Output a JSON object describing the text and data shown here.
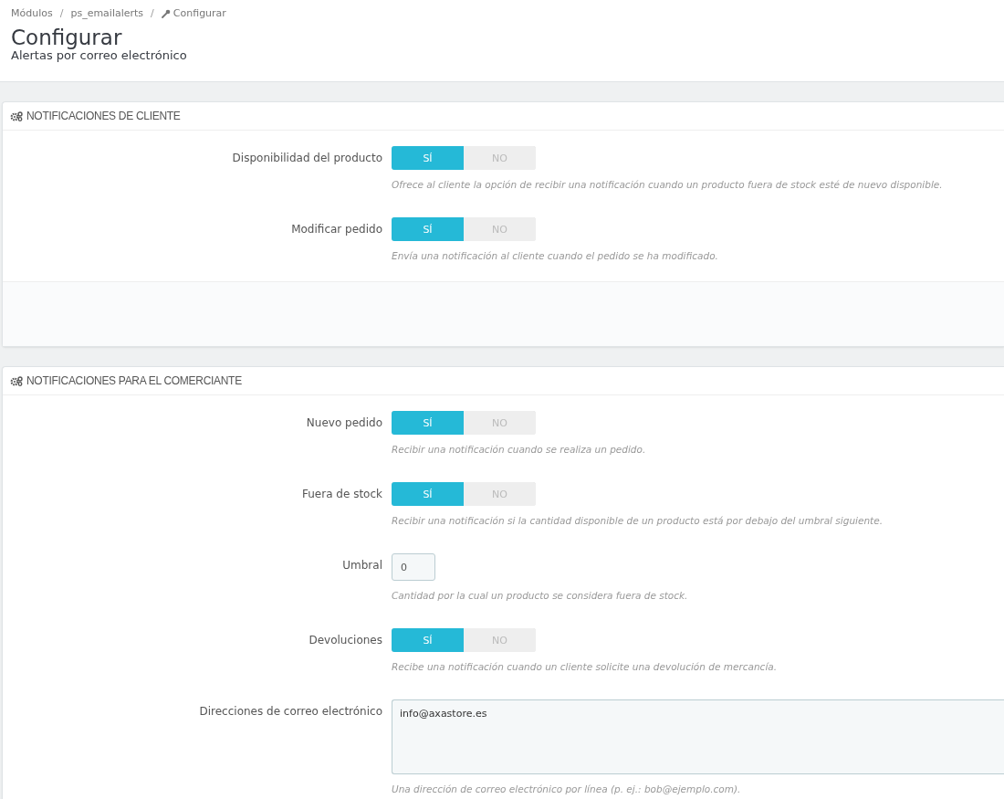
{
  "breadcrumb": [
    {
      "label": "Módulos",
      "icon": false
    },
    {
      "label": "ps_emailalerts",
      "icon": false
    },
    {
      "label": "Configurar",
      "icon": true
    }
  ],
  "breadcrumb_separators": [
    "/",
    "/"
  ],
  "page_title": "Configurar",
  "page_subtitle": "Alertas por correo electrónico",
  "panels": [
    {
      "title": "NOTIFICACIONES DE CLIENTE",
      "fields": [
        {
          "kind": "switch",
          "label": "Disponibilidad del producto",
          "options": [
            {
              "label": "SÍ",
              "selected": true
            },
            {
              "label": "NO",
              "selected": false
            }
          ],
          "help": "Ofrece al cliente la opción de recibir una notificación cuando un producto fuera de stock esté de nuevo disponible."
        },
        {
          "kind": "switch",
          "label": "Modificar pedido",
          "options": [
            {
              "label": "SÍ",
              "selected": true
            },
            {
              "label": "NO",
              "selected": false
            }
          ],
          "help": "Envía una notificación al cliente cuando el pedido se ha modificado."
        }
      ]
    },
    {
      "title": "NOTIFICACIONES PARA EL COMERCIANTE",
      "fields": [
        {
          "kind": "switch",
          "label": "Nuevo pedido",
          "options": [
            {
              "label": "SÍ",
              "selected": true
            },
            {
              "label": "NO",
              "selected": false
            }
          ],
          "help": "Recibir una notificación cuando se realiza un pedido."
        },
        {
          "kind": "switch",
          "label": "Fuera de stock",
          "options": [
            {
              "label": "SÍ",
              "selected": true
            },
            {
              "label": "NO",
              "selected": false
            }
          ],
          "help": "Recibir una notificación si la cantidad disponible de un producto está por debajo del umbral siguiente."
        },
        {
          "kind": "text",
          "label": "Umbral",
          "value": "0",
          "help": "Cantidad por la cual un producto se considera fuera de stock."
        },
        {
          "kind": "switch",
          "label": "Devoluciones",
          "options": [
            {
              "label": "SÍ",
              "selected": true
            },
            {
              "label": "NO",
              "selected": false
            }
          ],
          "help": "Recibe una notificación cuando un cliente solicite una devolución de mercancía."
        },
        {
          "kind": "textarea",
          "label": "Direcciones de correo electrónico",
          "value": "info@axastore.es",
          "help": "Una dirección de correo electrónico por línea (p. ej.: bob@ejemplo.com)."
        }
      ]
    }
  ]
}
